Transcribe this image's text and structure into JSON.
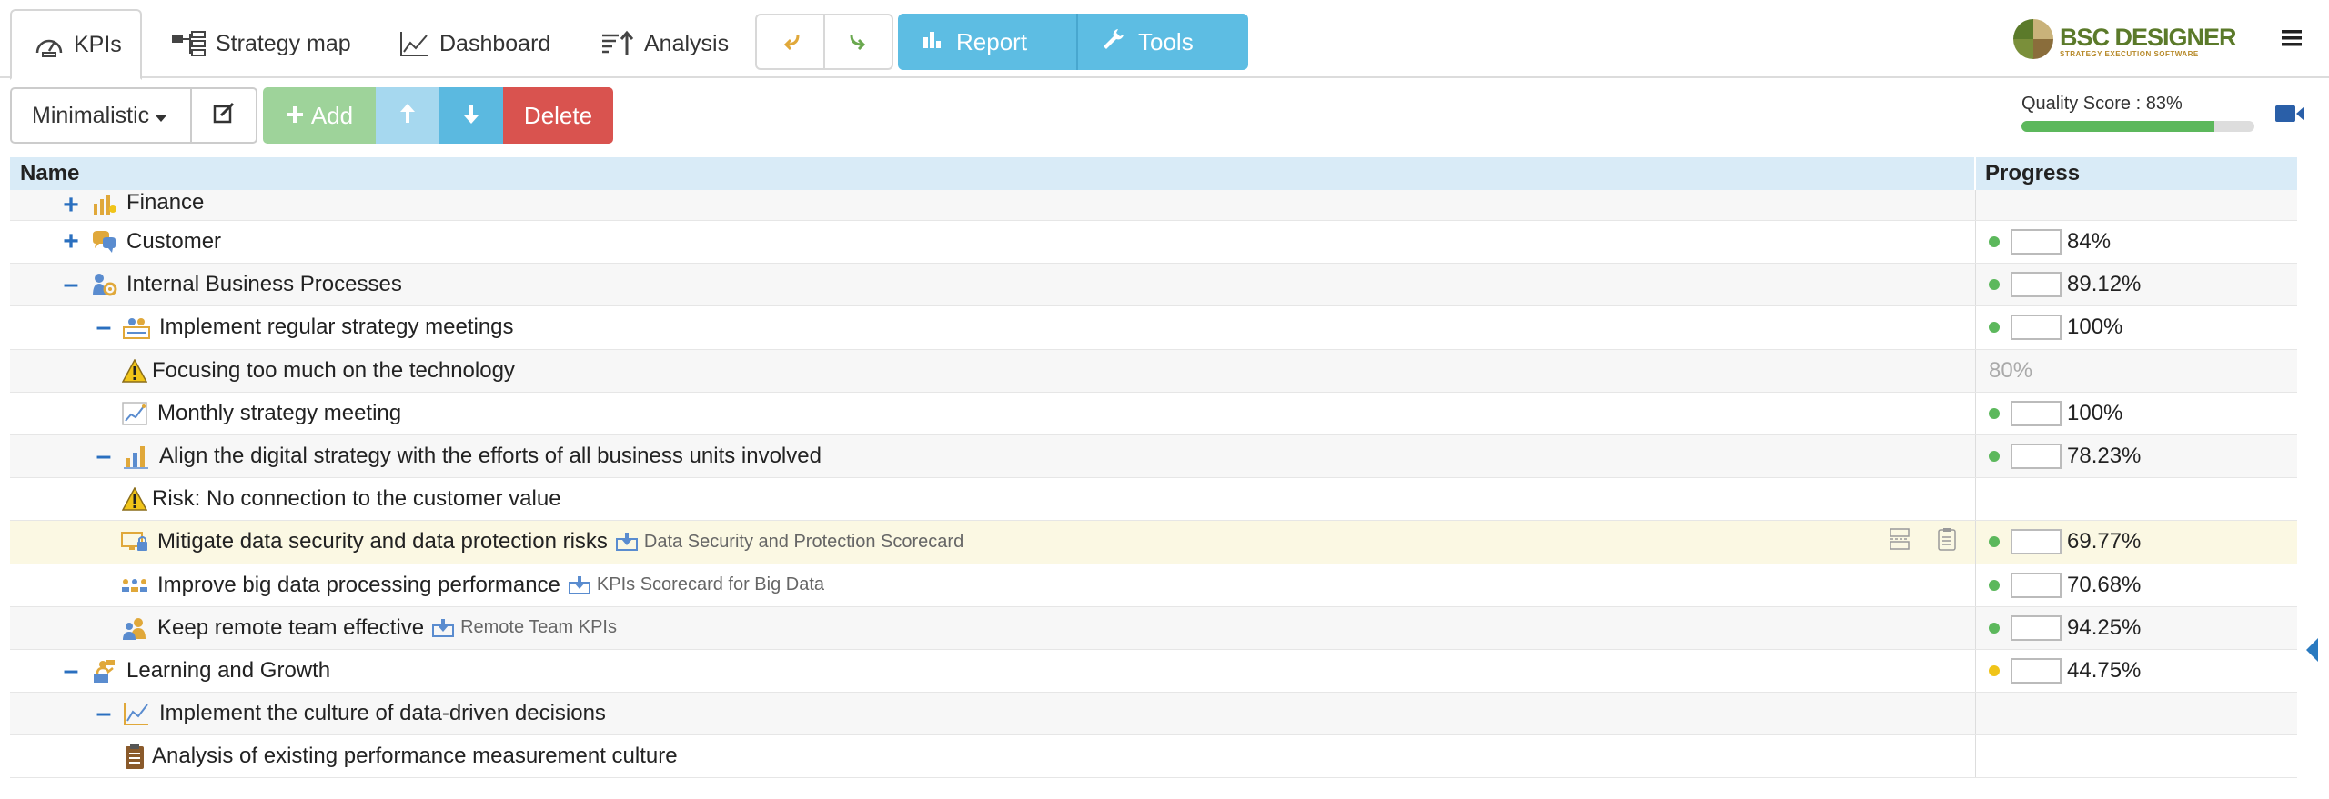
{
  "tabs": [
    {
      "label": "KPIs",
      "icon": "gauge-icon",
      "active": true
    },
    {
      "label": "Strategy map",
      "icon": "strategy-map-icon"
    },
    {
      "label": "Dashboard",
      "icon": "line-chart-icon"
    },
    {
      "label": "Analysis",
      "icon": "analysis-sort-icon"
    }
  ],
  "toolbar": {
    "report_label": "Report",
    "tools_label": "Tools"
  },
  "logo": {
    "main": "BSC DESIGNER",
    "sub": "STRATEGY EXECUTION SOFTWARE"
  },
  "view": {
    "selected": "Minimalistic"
  },
  "actions": {
    "add_label": "Add",
    "delete_label": "Delete"
  },
  "quality": {
    "label": "Quality Score : 83%",
    "value": 0.83
  },
  "grid": {
    "col_name": "Name",
    "col_progress": "Progress"
  },
  "rows": [
    {
      "indent": 0,
      "toggle": "+",
      "icon": "finance-icon",
      "name": "Finance",
      "progress": "",
      "dot": "",
      "box": false,
      "partial": true
    },
    {
      "indent": 0,
      "toggle": "+",
      "icon": "customer-icon",
      "name": "Customer",
      "progress": "84%",
      "dot": "#5cb85c",
      "box": true
    },
    {
      "indent": 0,
      "toggle": "–",
      "icon": "internal-process-icon",
      "name": "Internal Business Processes",
      "progress": "89.12%",
      "dot": "#5cb85c",
      "box": true
    },
    {
      "indent": 1,
      "toggle": "–",
      "icon": "meeting-icon",
      "name": "Implement regular strategy meetings",
      "progress": "100%",
      "dot": "#5cb85c",
      "box": true
    },
    {
      "indent": 2,
      "toggle": "",
      "icon": "warning-icon",
      "name": "Focusing too much on the technology",
      "progress": "80%",
      "dot": "",
      "box": false,
      "muted": true
    },
    {
      "indent": 2,
      "toggle": "",
      "icon": "trend-icon",
      "name": "Monthly strategy meeting",
      "progress": "100%",
      "dot": "#5cb85c",
      "box": true
    },
    {
      "indent": 1,
      "toggle": "–",
      "icon": "bar-chart-icon",
      "name": "Align the digital strategy with the efforts of all business units involved",
      "progress": "78.23%",
      "dot": "#5cb85c",
      "box": true
    },
    {
      "indent": 2,
      "toggle": "",
      "icon": "warning-icon",
      "name": "Risk: No connection to the customer value",
      "progress": "",
      "dot": "",
      "box": false
    },
    {
      "indent": 2,
      "toggle": "",
      "icon": "security-icon",
      "name": "Mitigate data security and data protection risks",
      "link": "Data Security and Protection Scorecard",
      "progress": "69.77%",
      "dot": "#5cb85c",
      "box": true,
      "highlight": true
    },
    {
      "indent": 2,
      "toggle": "",
      "icon": "big-data-icon",
      "name": "Improve big data processing performance",
      "link": "KPIs Scorecard for Big Data",
      "progress": "70.68%",
      "dot": "#5cb85c",
      "box": true
    },
    {
      "indent": 2,
      "toggle": "",
      "icon": "team-icon",
      "name": "Keep remote team effective",
      "link": "Remote Team KPIs",
      "progress": "94.25%",
      "dot": "#5cb85c",
      "box": true
    },
    {
      "indent": 0,
      "toggle": "–",
      "icon": "learning-icon",
      "name": "Learning and Growth",
      "progress": "44.75%",
      "dot": "#f0c419",
      "box": true
    },
    {
      "indent": 1,
      "toggle": "–",
      "icon": "line-chart-icon",
      "name": "Implement the culture of data-driven decisions",
      "progress": "",
      "dot": "",
      "box": false
    },
    {
      "indent": 2,
      "toggle": "",
      "icon": "clipboard-icon",
      "name": "Analysis of existing performance measurement culture",
      "progress": "",
      "dot": "",
      "box": false
    }
  ]
}
